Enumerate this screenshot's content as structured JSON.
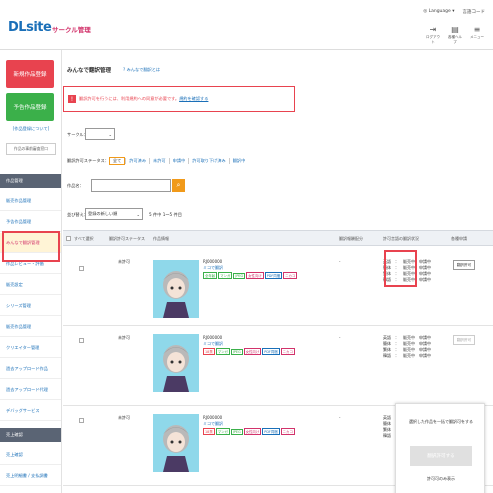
{
  "header": {
    "logo": "DLsite",
    "logo_sub": "サークル管理",
    "language": "Language",
    "chara_set": "言語コード",
    "icons": [
      {
        "icon": "logout-icon",
        "label": "ログアウト"
      },
      {
        "icon": "help-icon",
        "label": "各種ヘルプ"
      },
      {
        "icon": "menu-icon",
        "label": "メニュー"
      }
    ]
  },
  "sidebar": {
    "new_button": "新規作品登録",
    "plan_button": "予告作品登録",
    "link1": "[作品登録について]",
    "box1": "作品の事前審査窓口",
    "section1": "作品管理",
    "items": [
      "販売作品管理",
      "予告作品管理",
      "みんなで翻訳管理",
      "作品レビュー・評価",
      "販売設定",
      "シリーズ管理",
      "販売作品管理",
      "クリエイター管理",
      "過去アップロード作品",
      "過去アップロード代理",
      "デバッグサービス"
    ],
    "section2": "売上確認",
    "items2": [
      "売上確認",
      "売上明細書 / 支払調書"
    ]
  },
  "main": {
    "title": "みんなで翻訳管理",
    "title_link": "みんなで翻訳とは",
    "alert_text": "翻訳許可を行うには、利用規約への同意が必要です。",
    "alert_link": "規約を確認する",
    "circle_label": "サークル：",
    "status_label": "翻訳許可ステータス：",
    "statuses": [
      "全て",
      "許可済み",
      "未許可",
      "申請中",
      "許可取り下げ済み",
      "翻訳中"
    ],
    "work_label": "作品名：",
    "sort_label": "並び替え：",
    "sort_value": "登録の新しい順",
    "count_text": "5 件中 1〜5 件目",
    "columns": [
      "すべて選択",
      "翻訳許可ステータス",
      "作品情報",
      "翻訳報酬配分",
      "許可言語の翻訳状況",
      "各種申請"
    ],
    "rows": [
      {
        "status": "未許可",
        "id": "RJ000000",
        "title": "ミコで翻訳",
        "tags": [
          "全年齢",
          "マンガ",
          "JPEG",
          "女性向け",
          "PDF同梱",
          "ニカコ"
        ],
        "reward": "-",
        "langs": [
          "英語　：　販売中　申請中",
          "簡体　：　販売中　申請中",
          "繁体　：　販売中　申請中",
          "韓語　：　販売中　申請中"
        ],
        "action": "翻訳許可"
      },
      {
        "status": "未許可",
        "id": "RJ000000",
        "title": "ミコで翻訳",
        "tags": [
          "18禁",
          "マンガ",
          "JPEG",
          "女性向け",
          "PDF同梱",
          "ニカコ"
        ],
        "reward": "-",
        "langs": [
          "英語　：　販売中　申請中",
          "簡体　：　販売中　申請中",
          "繁体　：　販売中　申請中",
          "韓語　：　販売中　申請中"
        ],
        "action": "翻訳許可"
      },
      {
        "status": "未許可",
        "id": "RJ000000",
        "title": "ミコで翻訳",
        "tags": [
          "18禁",
          "マンガ",
          "JPEG",
          "女性向け",
          "PDF同梱",
          "ニカコ"
        ],
        "reward": "-",
        "langs": [
          "英語　：　販売中　申請中",
          "簡体　：　販売中　申請中",
          "繁体　：　販売中　申請中",
          "韓語　：　販売中　申請中"
        ],
        "action": ""
      }
    ],
    "floating_text": "選択した作品を一括で翻訳可をする",
    "floating_button": "翻訳許可する",
    "floating_note": "許可可のみ表示"
  },
  "colors": {
    "accent_red": "#e8434f",
    "accent_green": "#3bb04a",
    "accent_orange": "#f19a1a",
    "link_blue": "#1a6fb8"
  }
}
